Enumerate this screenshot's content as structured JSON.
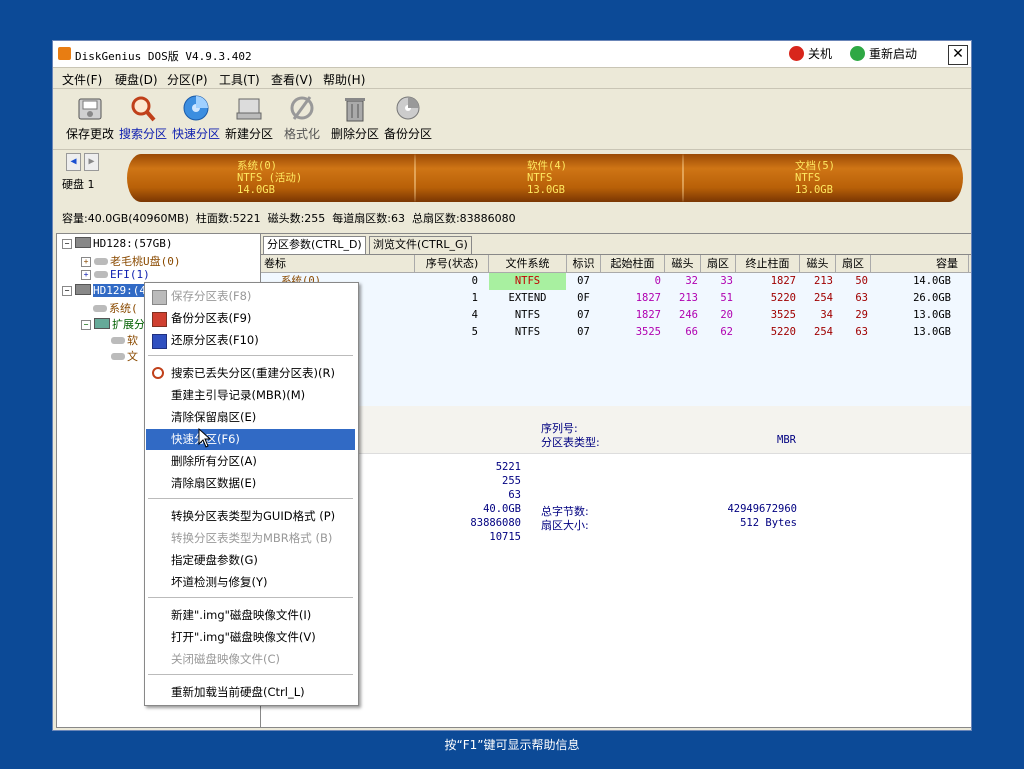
{
  "window": {
    "title": "DiskGenius DOS版 V4.9.3.402",
    "shutdown_label": "关机",
    "restart_label": "重新启动",
    "close_label": "✕"
  },
  "menu": [
    "文件(F)",
    "硬盘(D)",
    "分区(P)",
    "工具(T)",
    "查看(V)",
    "帮助(H)"
  ],
  "toolbar": {
    "save": "保存更改",
    "search": "搜索分区",
    "quick": "快速分区",
    "new": "新建分区",
    "format": "格式化",
    "delete": "删除分区",
    "backup": "备份分区"
  },
  "disk_bar": {
    "disk_label": "硬盘 1",
    "segments": [
      {
        "name": "系统(0)",
        "fs": "NTFS (活动)",
        "size": "14.0GB"
      },
      {
        "name": "软件(4)",
        "fs": "NTFS",
        "size": "13.0GB"
      },
      {
        "name": "文档(5)",
        "fs": "NTFS",
        "size": "13.0GB"
      }
    ]
  },
  "info_line": "容量:40.0GB(40960MB)  柱面数:5221  磁头数:255  每道扇区数:63  总扇区数:83886080",
  "tree": {
    "hd128": "HD128:(57GB)",
    "laomaotao": "老毛桃U盘(0)",
    "efi": "EFI(1)",
    "hd129": "HD129:(40",
    "sys": "系统(",
    "ext": "扩展分",
    "soft": "软",
    "doc": "文"
  },
  "tabs": {
    "params": "分区参数(CTRL_D)",
    "browse": "浏览文件(CTRL_G)"
  },
  "columns": [
    "卷标",
    "序号(状态)",
    "文件系统",
    "标识",
    "起始柱面",
    "磁头",
    "扇区",
    "终止柱面",
    "磁头",
    "扇区",
    "容量"
  ],
  "rows": [
    {
      "label": "系统(0)",
      "idx": "0",
      "fs": "NTFS",
      "id": "07",
      "sc": "0",
      "sh": "32",
      "ss": "33",
      "ec": "1827",
      "eh": "213",
      "es": "50",
      "cap": "14.0GB"
    },
    {
      "label": "",
      "idx": "1",
      "fs": "EXTEND",
      "id": "0F",
      "sc": "1827",
      "sh": "213",
      "ss": "51",
      "ec": "5220",
      "eh": "254",
      "es": "63",
      "cap": "26.0GB"
    },
    {
      "label": "",
      "idx": "4",
      "fs": "NTFS",
      "id": "07",
      "sc": "1827",
      "sh": "246",
      "ss": "20",
      "ec": "3525",
      "eh": "34",
      "es": "29",
      "cap": "13.0GB"
    },
    {
      "label": "",
      "idx": "5",
      "fs": "NTFS",
      "id": "07",
      "sc": "3525",
      "sh": "66",
      "ss": "62",
      "ec": "5220",
      "eh": "254",
      "es": "63",
      "cap": "13.0GB"
    }
  ],
  "details": {
    "serial_label": "序列号:",
    "pttype_label": "分区表类型:",
    "pttype_value": "MBR",
    "cyl": "5221",
    "heads": "255",
    "sectors": "63",
    "cap": "40.0GB",
    "total_sectors": "83886080",
    "extra": "10715",
    "total_bytes_label": "总字节数:",
    "total_bytes": "42949672960",
    "sector_size_label": "扇区大小:",
    "sector_size": "512 Bytes"
  },
  "context_menu": {
    "save_pt": "保存分区表(F8)",
    "backup_pt": "备份分区表(F9)",
    "restore_pt": "还原分区表(F10)",
    "search_lost": "搜索已丢失分区(重建分区表)(R)",
    "rebuild_mbr": "重建主引导记录(MBR)(M)",
    "clear_reserved": "清除保留扇区(E)",
    "quick_part": "快速分区(F6)",
    "delete_all": "删除所有分区(A)",
    "clear_sector": "清除扇区数据(E)",
    "to_guid": "转换分区表类型为GUID格式 (P)",
    "to_mbr": "转换分区表类型为MBR格式 (B)",
    "set_params": "指定硬盘参数(G)",
    "bad_track": "坏道检测与修复(Y)",
    "new_img": "新建\".img\"磁盘映像文件(I)",
    "open_img": "打开\".img\"磁盘映像文件(V)",
    "close_img": "关闭磁盘映像文件(C)",
    "reload": "重新加载当前硬盘(Ctrl_L)"
  },
  "status_text": "按“F1”键可显示帮助信息",
  "colors": {
    "background": "#0c4a97",
    "disk_bar": "#c06a10",
    "disk_text": "#ffe860",
    "selection": "#316ac5"
  }
}
